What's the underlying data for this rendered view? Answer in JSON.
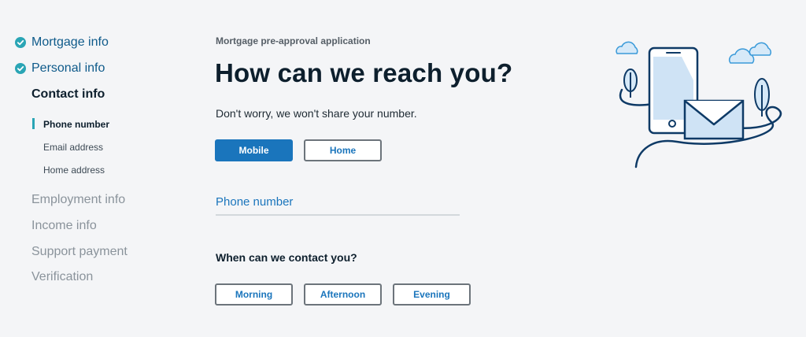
{
  "sidebar": {
    "steps": [
      {
        "label": "Mortgage info",
        "state": "done"
      },
      {
        "label": "Personal info",
        "state": "done"
      },
      {
        "label": "Contact info",
        "state": "active"
      },
      {
        "label": "Employment info",
        "state": "todo"
      },
      {
        "label": "Income info",
        "state": "todo"
      },
      {
        "label": "Support payment",
        "state": "todo"
      },
      {
        "label": "Verification",
        "state": "todo"
      }
    ],
    "substeps": [
      {
        "label": "Phone number",
        "current": true
      },
      {
        "label": "Email address",
        "current": false
      },
      {
        "label": "Home address",
        "current": false
      }
    ]
  },
  "main": {
    "eyebrow": "Mortgage pre-approval application",
    "title": "How can we reach you?",
    "subtitle": "Don't worry, we won't share your number.",
    "phone_type": {
      "options": [
        "Mobile",
        "Home"
      ],
      "selected": "Mobile"
    },
    "phone_field": {
      "label": "Phone number",
      "value": ""
    },
    "contact_time": {
      "title": "When can we contact you?",
      "options": [
        "Morning",
        "Afternoon",
        "Evening"
      ]
    }
  },
  "colors": {
    "accent": "#1a75bc",
    "check": "#2aa5b5",
    "text_dark": "#0d1f2d",
    "muted": "#8a939b",
    "background": "#f4f5f7"
  },
  "icons": {
    "check": "check-circle-icon",
    "illustration": "phone-and-envelope-illustration"
  }
}
